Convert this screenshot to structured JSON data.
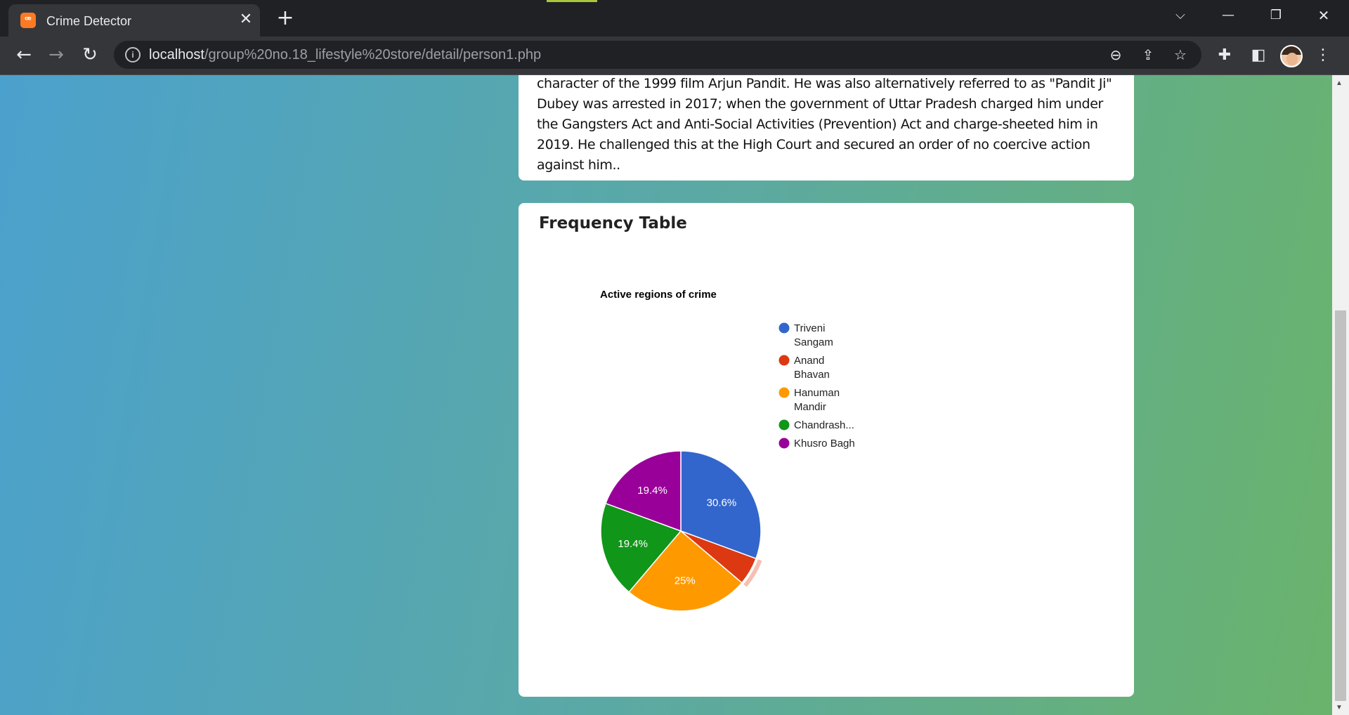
{
  "browser": {
    "tab_title": "Crime Detector",
    "tab_favicon": "xampp-favicon-icon",
    "url_host": "localhost",
    "url_path": "/group%20no.18_lifestyle%20store/detail/person1.php"
  },
  "bio_text": "character of the 1999 film Arjun Pandit. He was also alternatively referred to as \"Pandit Ji\" Dubey was arrested in 2017; when the government of Uttar Pradesh charged him under the Gangsters Act and Anti-Social Activities (Prevention) Act and charge-sheeted him in 2019. He challenged this at the High Court and secured an order of no coercive action against him..",
  "section_title": "Frequency Table",
  "chart_data": {
    "type": "pie",
    "title": "Active regions of crime",
    "legend_position": "right",
    "slices": [
      {
        "label": "Triveni Sangam",
        "legend": [
          "Triveni",
          "Sangam"
        ],
        "value": 30.6,
        "display": "30.6%",
        "color": "#3366cc"
      },
      {
        "label": "Anand Bhavan",
        "legend": [
          "Anand",
          "Bhavan"
        ],
        "value": 5.6,
        "display": "",
        "color": "#dc3912"
      },
      {
        "label": "Hanuman Mandir",
        "legend": [
          "Hanuman",
          "Mandir"
        ],
        "value": 25,
        "display": "25%",
        "color": "#ff9900"
      },
      {
        "label": "Chandrash...",
        "legend": [
          "Chandrash..."
        ],
        "value": 19.4,
        "display": "19.4%",
        "color": "#109618"
      },
      {
        "label": "Khusro Bagh",
        "legend": [
          "Khusro Bagh"
        ],
        "value": 19.4,
        "display": "19.4%",
        "color": "#990099"
      }
    ]
  }
}
